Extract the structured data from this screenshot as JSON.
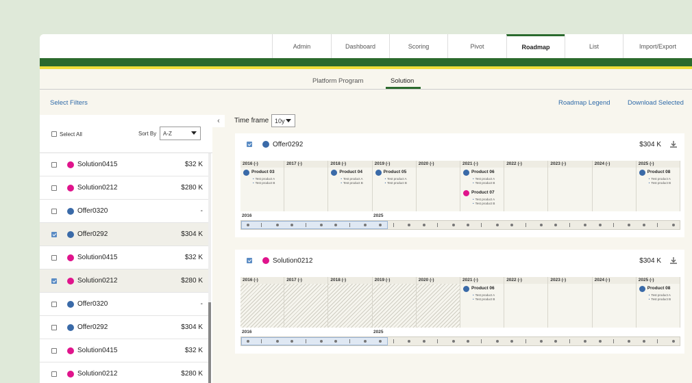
{
  "nav": {
    "tabs": [
      {
        "label": "Admin"
      },
      {
        "label": "Dashboard"
      },
      {
        "label": "Scoring"
      },
      {
        "label": "Pivot"
      },
      {
        "label": "Roadmap"
      },
      {
        "label": "List"
      },
      {
        "label": "Import/Export"
      }
    ],
    "active": "Roadmap"
  },
  "subtabs": [
    {
      "label": "Platform Program"
    },
    {
      "label": "Solution"
    }
  ],
  "actions": {
    "select_filters": "Select Filters",
    "roadmap_legend": "Roadmap Legend",
    "download_selected": "Download Selected"
  },
  "sidebar": {
    "select_all": "Select All",
    "sort_by_label": "Sort By",
    "sort_value": "A-Z",
    "items": [
      {
        "name": "Solution0415",
        "value": "$32 K",
        "color": "#e0148c",
        "checked": false
      },
      {
        "name": "Solution0212",
        "value": "$280 K",
        "color": "#e0148c",
        "checked": false
      },
      {
        "name": "Offer0320",
        "value": "-",
        "color": "#3a6aa8",
        "checked": false
      },
      {
        "name": "Offer0292",
        "value": "$304 K",
        "color": "#3a6aa8",
        "checked": true
      },
      {
        "name": "Solution0415",
        "value": "$32 K",
        "color": "#e0148c",
        "checked": false
      },
      {
        "name": "Solution0212",
        "value": "$280 K",
        "color": "#e0148c",
        "checked": true
      },
      {
        "name": "Offer0320",
        "value": "-",
        "color": "#3a6aa8",
        "checked": false
      },
      {
        "name": "Offer0292",
        "value": "$304 K",
        "color": "#3a6aa8",
        "checked": false
      },
      {
        "name": "Solution0415",
        "value": "$32 K",
        "color": "#e0148c",
        "checked": false
      },
      {
        "name": "Solution0212",
        "value": "$280 K",
        "color": "#e0148c",
        "checked": false
      }
    ]
  },
  "timeframe": {
    "label": "Time frame",
    "value": "10y"
  },
  "years": [
    "2016",
    "2017",
    "2018",
    "2019",
    "2020",
    "2021",
    "2022",
    "2023",
    "2024",
    "2025"
  ],
  "year_suffix": "(-)",
  "cards": [
    {
      "name": "Offer0292",
      "value": "$304 K",
      "color": "#3a6aa8",
      "slider_start": "2016",
      "slider_end": "2025",
      "products": [
        {
          "name": "Product 03",
          "color": "#3a6aa8",
          "subs": [
            "Test product A",
            "Test product B"
          ]
        },
        {
          "name": "Product 04",
          "color": "#3a6aa8",
          "subs": [
            "Test product A",
            "Test product B"
          ]
        },
        {
          "name": "Product 05",
          "color": "#3a6aa8",
          "subs": [
            "Test product A",
            "Test product B"
          ]
        },
        {
          "name": "Product 06",
          "color": "#3a6aa8",
          "subs": [
            "Test product A",
            "Test product B"
          ]
        },
        {
          "name": "Product 07",
          "color": "#e0148c",
          "subs": [
            "Test product A",
            "Test product B"
          ]
        },
        {
          "name": "Product 08",
          "color": "#3a6aa8",
          "subs": [
            "Test product A",
            "Test product B"
          ]
        }
      ]
    },
    {
      "name": "Solution0212",
      "value": "$304 K",
      "color": "#e0148c",
      "slider_start": "2016",
      "slider_end": "2025",
      "products": [
        {
          "name": "Product 06",
          "color": "#3a6aa8",
          "subs": [
            "Test product A",
            "Test product B"
          ]
        },
        {
          "name": "Product 08",
          "color": "#3a6aa8",
          "subs": [
            "Test product A",
            "Test product B"
          ]
        }
      ]
    }
  ],
  "colors": {
    "brand_green": "#2b6a2d",
    "accent_yellow": "#f0de3a",
    "link_blue": "#2f6aa8",
    "offer_blue": "#3a6aa8",
    "solution_magenta": "#e0148c"
  }
}
